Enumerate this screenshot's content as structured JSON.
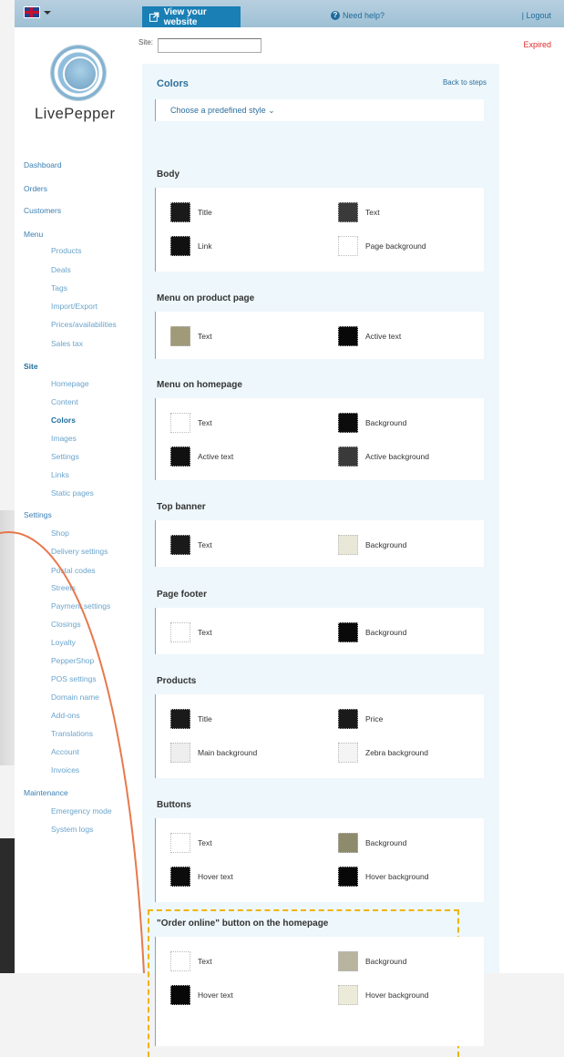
{
  "topbar": {
    "view_website": "View your website",
    "need_help": "Need help?",
    "logout": "| Logout"
  },
  "header": {
    "site_label": "Site:",
    "site_value": "",
    "status": "Expired"
  },
  "brand": "LivePepper",
  "nav": {
    "dashboard": "Dashboard",
    "orders": "Orders",
    "customers": "Customers",
    "menu": "Menu",
    "menu_items": [
      "Products",
      "Deals",
      "Tags",
      "Import/Export",
      "Prices/availabilities",
      "Sales tax"
    ],
    "site": "Site",
    "site_items": [
      "Homepage",
      "Content",
      "Colors",
      "Images",
      "Settings",
      "Links",
      "Static pages"
    ],
    "settings": "Settings",
    "settings_items": [
      "Shop",
      "Delivery settings",
      "Postal codes",
      "Streets",
      "Payment settings",
      "Closings",
      "Loyalty",
      "PepperShop",
      "POS settings",
      "Domain name",
      "Add-ons",
      "Translations",
      "Account",
      "Invoices"
    ],
    "maintenance": "Maintenance",
    "maintenance_items": [
      "Emergency mode",
      "System logs"
    ]
  },
  "colors": {
    "title": "Colors",
    "back_to_steps": "Back to steps",
    "predefined": "Choose a predefined style ⌄",
    "sections": [
      {
        "title": "Body",
        "items": [
          {
            "label": "Title",
            "color": "#1a1a1a"
          },
          {
            "label": "Text",
            "color": "#3a3a3a"
          },
          {
            "label": "Link",
            "color": "#111111"
          },
          {
            "label": "Page background",
            "color": "#ffffff"
          }
        ]
      },
      {
        "title": "Menu on product page",
        "items": [
          {
            "label": "Text",
            "color": "#a09a78"
          },
          {
            "label": "Active text",
            "color": "#080808"
          }
        ]
      },
      {
        "title": "Menu on homepage",
        "items": [
          {
            "label": "Text",
            "color": "#ffffff"
          },
          {
            "label": "Background",
            "color": "#0c0c0c"
          },
          {
            "label": "Active text",
            "color": "#111111"
          },
          {
            "label": "Active background",
            "color": "#3a3a3a"
          }
        ]
      },
      {
        "title": "Top banner",
        "items": [
          {
            "label": "Text",
            "color": "#1a1a1a"
          },
          {
            "label": "Background",
            "color": "#e9e8d8"
          }
        ]
      },
      {
        "title": "Page footer",
        "items": [
          {
            "label": "Text",
            "color": "#ffffff"
          },
          {
            "label": "Background",
            "color": "#0a0a0a"
          }
        ]
      },
      {
        "title": "Products",
        "items": [
          {
            "label": "Title",
            "color": "#1a1a1a"
          },
          {
            "label": "Price",
            "color": "#1a1a1a"
          },
          {
            "label": "Main background",
            "color": "#eeeeee"
          },
          {
            "label": "Zebra background",
            "color": "#f4f4f4"
          }
        ]
      },
      {
        "title": "Buttons",
        "items": [
          {
            "label": "Text",
            "color": "#ffffff"
          },
          {
            "label": "Background",
            "color": "#8e8a6c"
          },
          {
            "label": "Hover text",
            "color": "#0c0c0c"
          },
          {
            "label": "Hover background",
            "color": "#080808"
          }
        ]
      },
      {
        "title": "\"Order online\" button on the homepage",
        "items": [
          {
            "label": "Text",
            "color": "#ffffff"
          },
          {
            "label": "Background",
            "color": "#b8b49f"
          },
          {
            "label": "Hover text",
            "color": "#080808"
          },
          {
            "label": "Hover background",
            "color": "#ecebd9"
          }
        ]
      }
    ]
  }
}
